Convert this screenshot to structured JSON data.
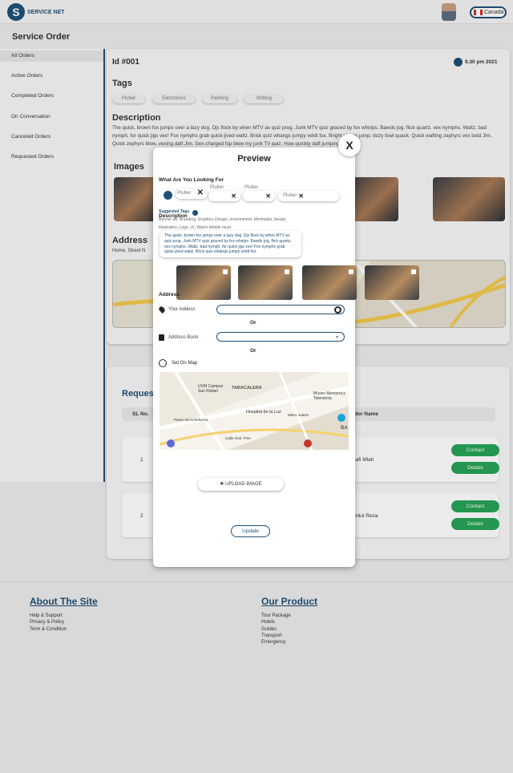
{
  "header": {
    "brand": "SERVICE NET",
    "country": "Canada"
  },
  "page_title": "Service Order",
  "sidebar": {
    "items": [
      {
        "label": "All Orders"
      },
      {
        "label": "Active Orders"
      },
      {
        "label": "Completed Orders"
      },
      {
        "label": "On Conversation"
      },
      {
        "label": "Canceled Orders"
      },
      {
        "label": "Requested Orders"
      }
    ]
  },
  "order": {
    "id": "Id #001",
    "time": "9.30 pm 2021",
    "tags_title": "Tags",
    "tags": [
      "Pluber",
      "Electronics",
      "Painting",
      "Shifting"
    ],
    "description_title": "Description",
    "description": "The quick, brown fox jumps over a lazy dog. Djs flock by when MTV ax quiz prog. Junk MTV quiz graced by fox whelps. Bawds jog, flick quartz, vex nymphs. Waltz, bad nymph, for quick jigs vex! Fox nymphs grab quick-jived waltz. Brick quiz whangs jumpy veldt fox. Bright vixens jump; dozy fowl quack. Quick wafting zephyrs vex bold Jim. Quick zephyrs blow, vexing daft Jim. Sex-charged fop blew my junk TV quiz. How quickly daft jumping.",
    "images_title": "Images",
    "address_title": "Address",
    "address_text": "Home, Street N"
  },
  "requests": {
    "title": "Reques",
    "columns": {
      "sl": "SL No.",
      "vendor": "dor Name"
    },
    "rows": [
      {
        "sl": "1",
        "vendor": "hafi Mlah",
        "contact": "Contact",
        "details": "Details"
      },
      {
        "sl": "2",
        "vendor": "ordul Reza",
        "contact": "Contact",
        "details": "Details"
      }
    ]
  },
  "footer": {
    "about_title": "About The Site",
    "about_links": [
      "Help & Support",
      "Privacy & Policy",
      "Term & Condition"
    ],
    "product_title": "Our Product",
    "product_links": [
      "Tour Package",
      "Hotels",
      "Guides",
      "Transport",
      "Emergency"
    ]
  },
  "modal": {
    "title": "Preview",
    "close": "X",
    "looking_for_label": "What Are You Looking For",
    "search_value": "Pluber",
    "chip_labels": [
      "Pluber",
      "Pluber"
    ],
    "chip_value": "Pluber",
    "suggested_label": "Suggested Tags",
    "description_label": "Description",
    "suggested_text": "Banner ad, Branding, Graphics Design, environment, Minimalist, design, Illustration, Logo, UI, Watch dribble must",
    "description_text": "The quick, brown fox jumps over a lazy dog. Djs flock by when MTV ax quiz prog. Junk MTV quiz graced by fox whelps. Bawds jog, flick quartz, vex nymphs. Waltz, bad nymph, for quick jigs vex! Fox nymphs grab quick-jived waltz. Brick quiz whangs jumpy veldt fox.",
    "address_label": "Address",
    "your_address_label": "Your Addess",
    "or1": "Or",
    "address_book_label": "Address Book",
    "or2": "Or",
    "set_on_map_label": "Set On Map",
    "map_labels": [
      "TABACALERA",
      "UVM Campus San Rafael",
      "Hospital de la Luz",
      "Museo Memoria y Tolerancia",
      "Metro Juárez",
      "Paseo de la Reforma",
      "Calle Gral. Prim",
      "BA"
    ],
    "upload_label": "UPLOAD IMAGE",
    "update_label": "Update"
  },
  "colors": {
    "brand": "#1f4f75",
    "green": "#27a357"
  }
}
